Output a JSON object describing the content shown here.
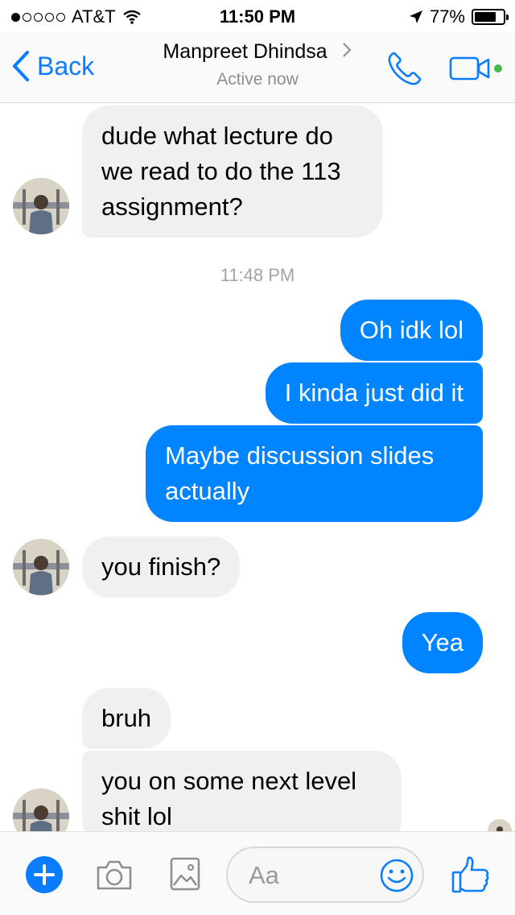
{
  "status_bar": {
    "signal_dots_filled": 1,
    "signal_dots_total": 5,
    "carrier": "AT&T",
    "time": "11:50 PM",
    "battery_percent": "77%",
    "battery_level": 0.77,
    "icons": [
      "wifi-icon",
      "location-arrow-icon",
      "battery-icon"
    ]
  },
  "nav": {
    "back_label": "Back",
    "contact_name": "Manpreet Dhindsa",
    "contact_status": "Active now",
    "icons": [
      "chevron-left-icon",
      "chevron-right-icon",
      "phone-icon",
      "video-camera-icon"
    ],
    "accent_color": "#0a7cff",
    "active_dot_color": "#44bb44"
  },
  "messages": [
    {
      "from": "them",
      "text": "dude what lecture do we read to do the 113 assignment?"
    },
    {
      "timestamp": "11:48 PM"
    },
    {
      "from": "me",
      "text": "Oh idk lol"
    },
    {
      "from": "me",
      "text": "I kinda just did it"
    },
    {
      "from": "me",
      "text": "Maybe discussion slides actually"
    },
    {
      "from": "them",
      "text": "you finish?"
    },
    {
      "from": "me",
      "text": "Yea"
    },
    {
      "from": "them",
      "text": "bruh"
    },
    {
      "from": "them",
      "text": "you on some next level shit lol"
    }
  ],
  "colors": {
    "outgoing_bubble": "#0084ff",
    "incoming_bubble": "#f1f0f0"
  },
  "composer": {
    "placeholder": "Aa",
    "icons": [
      "plus-icon",
      "camera-icon",
      "image-icon",
      "smiley-icon",
      "thumbs-up-icon"
    ]
  }
}
